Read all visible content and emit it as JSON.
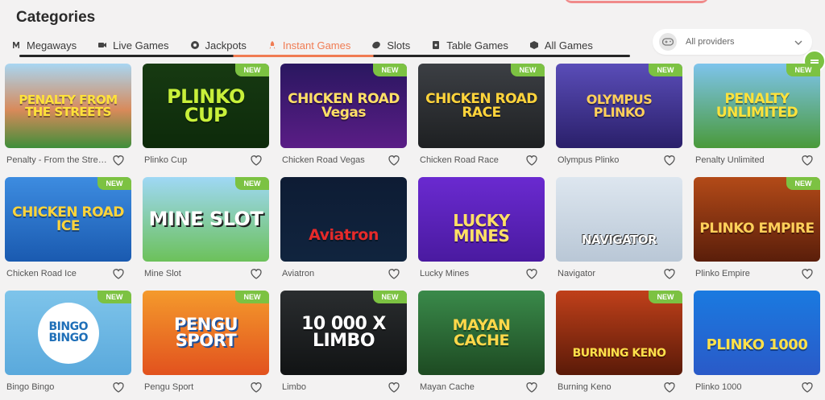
{
  "header": {
    "title": "Categories"
  },
  "tabs": [
    {
      "label": "Megaways",
      "icon": "megaways-icon",
      "active": false
    },
    {
      "label": "Live Games",
      "icon": "video-camera-icon",
      "active": false
    },
    {
      "label": "Jackpots",
      "icon": "jackpot-icon",
      "active": false
    },
    {
      "label": "Instant Games",
      "icon": "rocket-icon",
      "active": true
    },
    {
      "label": "Slots",
      "icon": "slots-icon",
      "active": false
    },
    {
      "label": "Table Games",
      "icon": "cards-icon",
      "active": false
    },
    {
      "label": "All Games",
      "icon": "all-games-icon",
      "active": false
    }
  ],
  "provider_select": {
    "value": "All providers",
    "icon": "gamepad-icon"
  },
  "badge_label": "NEW",
  "colors": {
    "accent": "#f07c53",
    "badge": "#7cc242",
    "background": "#f3f2f2"
  },
  "games": [
    {
      "name": "Penalty - From the Streets",
      "logo": "PENALTY FROM THE STREETS",
      "new": false
    },
    {
      "name": "Plinko Cup",
      "logo": "PLINKO CUP",
      "new": true
    },
    {
      "name": "Chicken Road Vegas",
      "logo": "CHICKEN ROAD Vegas",
      "new": true
    },
    {
      "name": "Chicken Road Race",
      "logo": "CHICKEN ROAD RACE",
      "new": true
    },
    {
      "name": "Olympus Plinko",
      "logo": "OLYMPUS PLINKO",
      "new": true
    },
    {
      "name": "Penalty Unlimited",
      "logo": "PENALTY UNLIMITED",
      "new": true
    },
    {
      "name": "Chicken Road Ice",
      "logo": "CHICKEN ROAD ICE",
      "new": true
    },
    {
      "name": "Mine Slot",
      "logo": "MINE SLOT",
      "new": true
    },
    {
      "name": "Aviatron",
      "logo": "Aviatron",
      "new": false
    },
    {
      "name": "Lucky Mines",
      "logo": "LUCKY MINES",
      "new": false
    },
    {
      "name": "Navigator",
      "logo": "NAVIGATOR",
      "new": false
    },
    {
      "name": "Plinko Empire",
      "logo": "PLINKO EMPIRE",
      "new": true
    },
    {
      "name": "Bingo Bingo",
      "logo": "BINGO BINGO",
      "new": true
    },
    {
      "name": "Pengu Sport",
      "logo": "PENGU SPORT",
      "new": true
    },
    {
      "name": "Limbo",
      "logo": "10 000 X LIMBO",
      "new": true
    },
    {
      "name": "Mayan Cache",
      "logo": "MAYAN CACHE",
      "new": false
    },
    {
      "name": "Burning Keno",
      "logo": "BURNING KENO",
      "new": true
    },
    {
      "name": "Plinko 1000",
      "logo": "PLINKO 1000",
      "new": false
    }
  ]
}
